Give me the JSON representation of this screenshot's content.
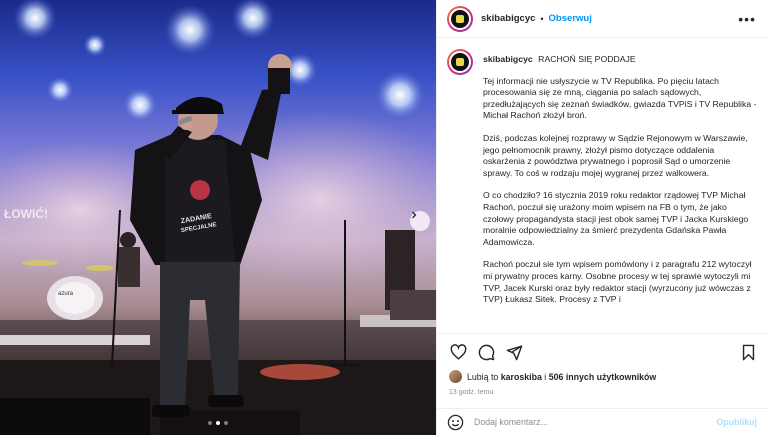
{
  "post": {
    "username": "skibabigcyc",
    "separator": "•",
    "follow_label": "Obserwuj",
    "more_label": "•••",
    "caption_title": "RACHOŃ SIĘ PODDAJE",
    "paragraphs": [
      "Tej informacji nie usłyszycie w TV Republika. Po pięciu latach procesowania się ze mną, ciągania po salach sądowych, przedłużających się zeznań świadków, gwiazda TVPiS i TV Republika - Michał Rachoń złożył broń.",
      "Dziś, podczas kolejnej rozprawy w Sądzie Rejonowym w Warszawie, jego pełnomocnik prawny, złożył pismo dotyczące oddalenia oskarżenia z powództwa prywatnego i poprosił Sąd o umorzenie sprawy. To coś w rodzaju mojej wygranej przez walkowera.",
      "O co chodziło? 16 stycznia 2019 roku redaktor rządowej TVP Michał Rachoń, poczuł się urażony moim wpisem na FB o tym, że jako czołowy propagandysta stacji jest obok samej TVP i Jacka Kurskiego moralnie odpowiedzialny za śmierć prezydenta Gdańska Pawła Adamowicza.",
      "Rachoń poczuł sie tym wpisem pomówiony i z paragrafu 212 wytoczył mi prywatny proces karny. Osobne procesy w tej sprawie wytoczyli mi TVP, Jacek Kurski oraz były redaktor stacji (wyrzucony już wówczas z TVP) Łukasz Sitek. Procesy z TVP i"
    ],
    "likes_prefix": "Lubią to",
    "likes_user": "karoskiba",
    "likes_connector": "i",
    "likes_others": "506 innych użytkowników",
    "time_ago": "13 godz. temu"
  },
  "comment": {
    "placeholder": "Dodaj komentarz...",
    "publish_label": "Opublikuj"
  },
  "media": {
    "shirt_text_line1": "ZADANIE",
    "shirt_text_line2": "SPECJALNE",
    "drum_text": "azura",
    "carousel_count": 3,
    "carousel_active_index": 1
  },
  "icons": [
    "heart-icon",
    "comment-icon",
    "share-icon",
    "bookmark-icon",
    "emoji-icon",
    "more-icon",
    "chevron-right-icon"
  ],
  "colors": {
    "accent": "#0095f6",
    "publish_disabled": "#b2dffc",
    "secondary_text": "#8e8e8e",
    "border": "#efefef"
  }
}
